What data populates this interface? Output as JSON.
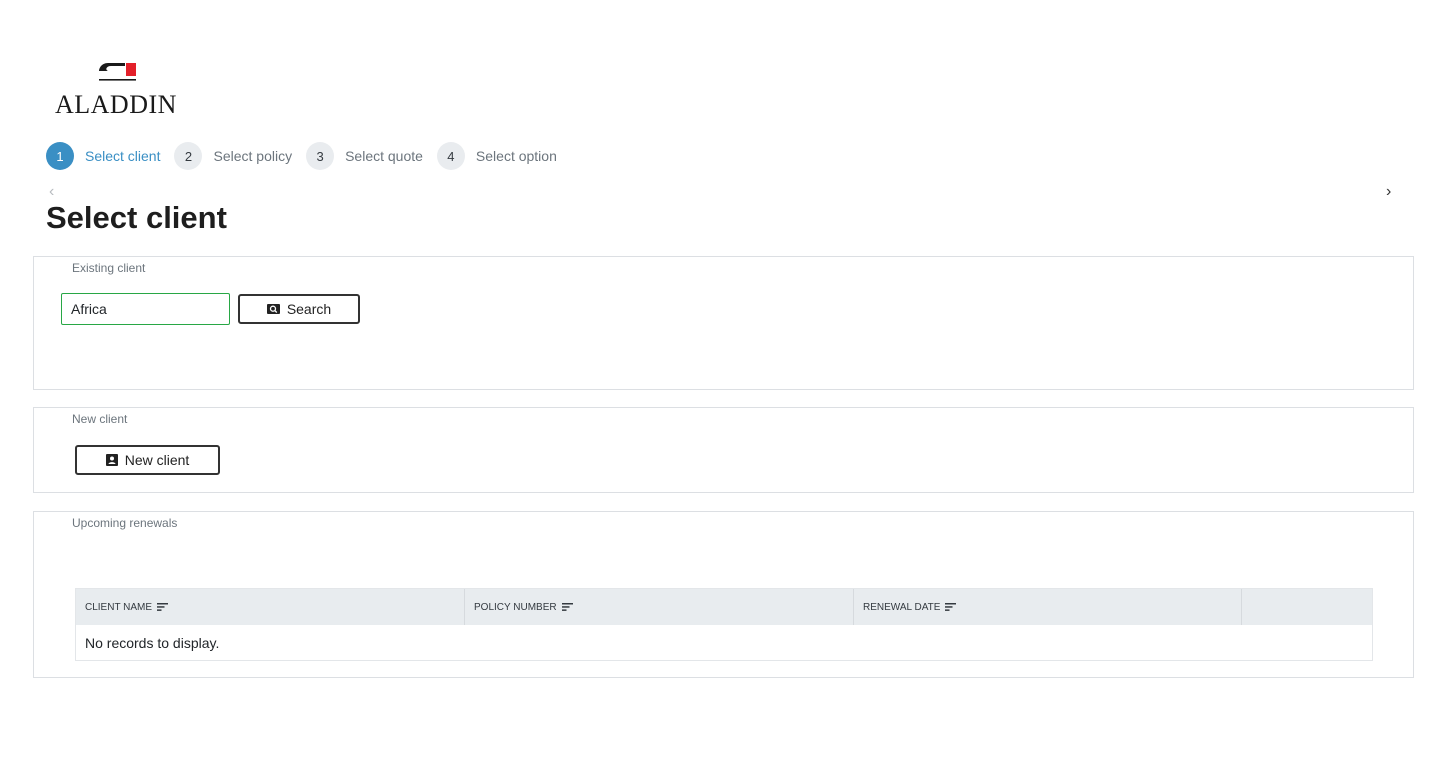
{
  "logo": {
    "text": "ALADDIN",
    "icon": "aladdin-logo-mark",
    "accent_color": "#e3202a"
  },
  "stepper": {
    "active_color": "#3a8fc4",
    "steps": [
      {
        "number": "1",
        "label": "Select client",
        "active": true
      },
      {
        "number": "2",
        "label": "Select policy",
        "active": false
      },
      {
        "number": "3",
        "label": "Select quote",
        "active": false
      },
      {
        "number": "4",
        "label": "Select option",
        "active": false
      }
    ]
  },
  "nav": {
    "prev_icon": "chevron-left-icon",
    "next_icon": "chevron-right-icon",
    "prev_glyph": "‹",
    "next_glyph": "›"
  },
  "page": {
    "title": "Select client"
  },
  "existing_client": {
    "legend": "Existing client",
    "search_value": "Africa",
    "search_button_label": "Search",
    "search_icon": "search-icon"
  },
  "new_client": {
    "legend": "New client",
    "button_label": "New client",
    "button_icon": "contact-card-icon"
  },
  "renewals": {
    "legend": "Upcoming renewals",
    "columns": [
      "CLIENT NAME",
      "POLICY NUMBER",
      "RENEWAL DATE",
      ""
    ],
    "sort_icon": "sort-icon",
    "empty_message": "No records to display."
  }
}
